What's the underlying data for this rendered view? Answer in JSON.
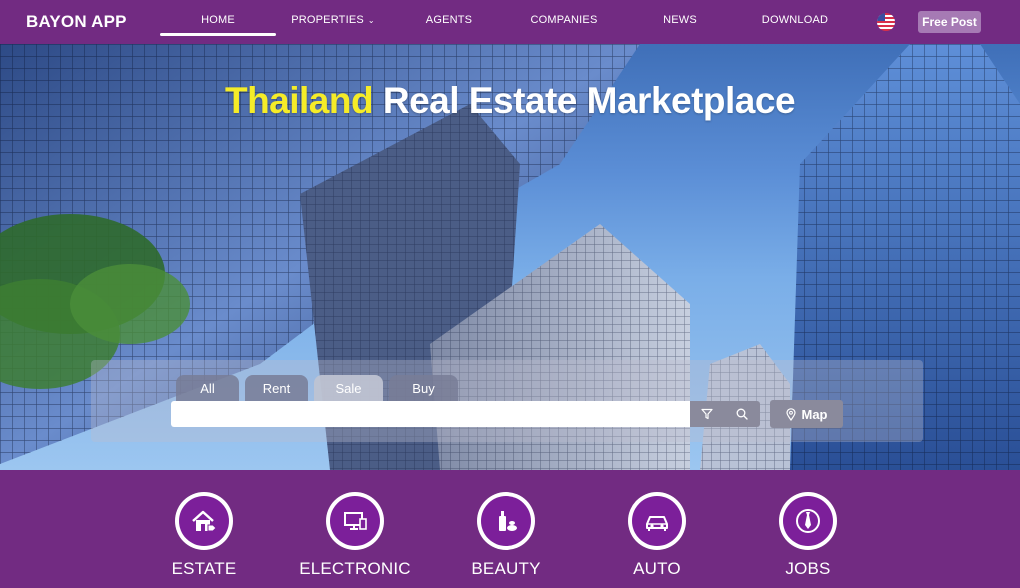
{
  "navbar": {
    "brand": "BAYON APP",
    "items": [
      {
        "label": "HOME",
        "active": true
      },
      {
        "label": "PROPERTIES",
        "has_dropdown": true
      },
      {
        "label": "AGENTS"
      },
      {
        "label": "COMPANIES"
      },
      {
        "label": "NEWS"
      },
      {
        "label": "DOWNLOAD"
      }
    ],
    "language_icon": "us-flag-icon",
    "free_post_label": "Free Post"
  },
  "hero": {
    "title_highlight": "Thailand",
    "title_rest": " Real Estate Marketplace",
    "highlight_color": "#f5ec28",
    "tabs": [
      {
        "label": "All"
      },
      {
        "label": "Rent"
      },
      {
        "label": "Sale",
        "selected": true
      },
      {
        "label": "Buy"
      }
    ],
    "search": {
      "value": "",
      "placeholder": ""
    },
    "filter_icon": "filter-icon",
    "search_icon": "search-icon",
    "map_label": "Map",
    "map_icon": "map-pin-icon"
  },
  "categories": [
    {
      "label": "ESTATE",
      "icon": "house-tag-icon"
    },
    {
      "label": "ELECTRONIC",
      "icon": "computer-icon"
    },
    {
      "label": "BEAUTY",
      "icon": "cosmetics-icon"
    },
    {
      "label": "AUTO",
      "icon": "car-icon"
    },
    {
      "label": "JOBS",
      "icon": "tie-icon"
    }
  ],
  "colors": {
    "brand_purple": "#722b82",
    "icon_purple": "#7c1f9a"
  }
}
